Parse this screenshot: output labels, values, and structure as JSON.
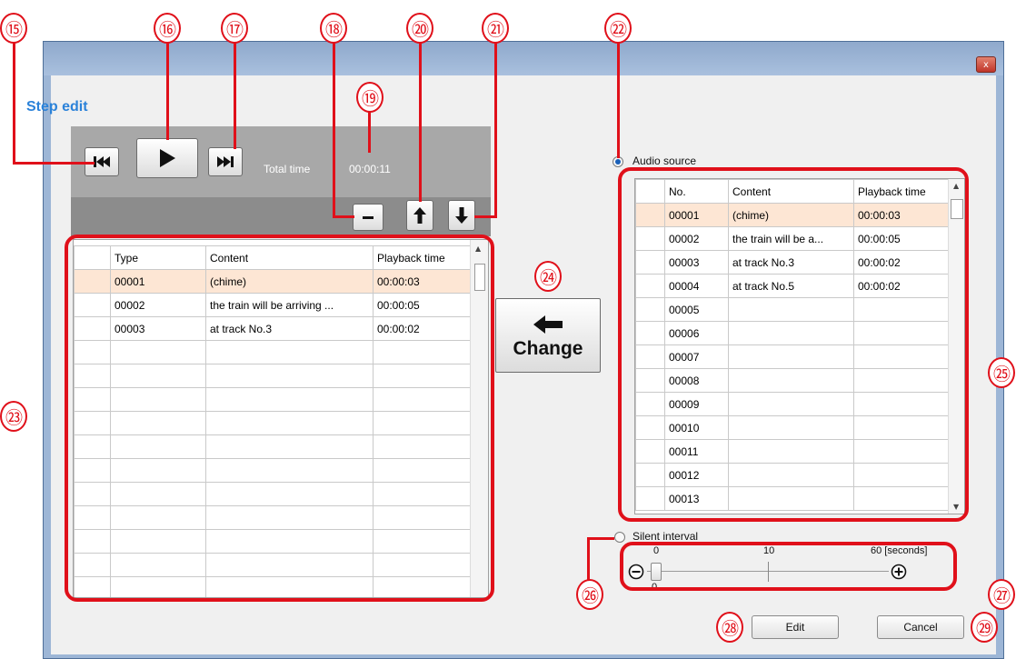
{
  "window": {
    "close_glyph": "x"
  },
  "step_edit": {
    "title": "Step edit",
    "total_time_label": "Total time",
    "total_time_value": "00:00:11",
    "headers": [
      "Type",
      "Content",
      "Playback time"
    ],
    "rows": [
      [
        "00001",
        "(chime)",
        "00:00:03"
      ],
      [
        "00002",
        "the train will be arriving ...",
        "00:00:05"
      ],
      [
        "00003",
        "at track No.3",
        "00:00:02"
      ]
    ]
  },
  "change_button": {
    "label": "Change"
  },
  "audio_source": {
    "label": "Audio source",
    "selected": true,
    "headers": [
      "No.",
      "Content",
      "Playback time"
    ],
    "rows": [
      [
        "00001",
        "(chime)",
        "00:00:03"
      ],
      [
        "00002",
        "the train will be a...",
        "00:00:05"
      ],
      [
        "00003",
        "at track No.3",
        "00:00:02"
      ],
      [
        "00004",
        "at track No.5",
        "00:00:02"
      ],
      [
        "00005",
        "",
        ""
      ],
      [
        "00006",
        "",
        ""
      ],
      [
        "00007",
        "",
        ""
      ],
      [
        "00008",
        "",
        ""
      ],
      [
        "00009",
        "",
        ""
      ],
      [
        "00010",
        "",
        ""
      ],
      [
        "00011",
        "",
        ""
      ],
      [
        "00012",
        "",
        ""
      ],
      [
        "00013",
        "",
        ""
      ]
    ]
  },
  "silent_interval": {
    "label": "Silent interval",
    "selected": false,
    "scale_min": "0",
    "scale_mid": "10",
    "scale_max": "60 [seconds]",
    "value": "0"
  },
  "buttons": {
    "edit": "Edit",
    "cancel": "Cancel"
  },
  "callouts": [
    "⑮",
    "⑯",
    "⑰",
    "⑱",
    "⑲",
    "⑳",
    "㉑",
    "㉒",
    "㉓",
    "㉔",
    "㉕",
    "㉖",
    "㉗",
    "㉘",
    "㉙"
  ],
  "colors": {
    "accent_title": "#2b82d9",
    "callout_red": "#e0101a",
    "selected_row": "#fde6d4"
  }
}
